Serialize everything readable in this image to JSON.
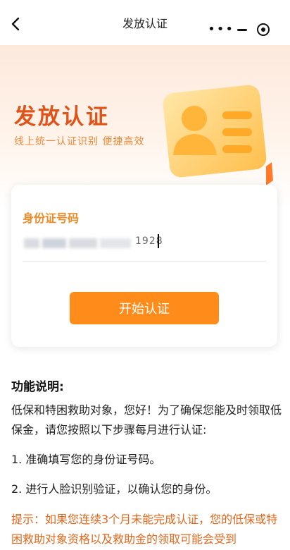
{
  "nav": {
    "title": "发放认证",
    "back_icon": "chevron-left-icon",
    "menu_icon": "more-dots-icon",
    "minimize_icon": "minus-icon",
    "close_icon": "target-circle-icon"
  },
  "hero": {
    "title": "发放认证",
    "subtitle": "线上统一认证识别 便捷高效",
    "illustration": "id-card-icon",
    "accent_color": "#e0541a"
  },
  "form": {
    "id_label": "身份证号码",
    "id_value_visible": "1928",
    "start_button": "开始认证",
    "button_color": "#ff8c1a"
  },
  "info": {
    "heading": "功能说明:",
    "intro": "低保和特困救助对象，您好！为了确保您能及时领取低保金，请您按照以下步骤每月进行认证:",
    "step1": "1. 准确填写您的身份证号码。",
    "step2": "2. 进行人脸识别验证，以确认您的身份。",
    "tip": "提示：如果您连续3个月未能完成认证，您的低保或特困救助对象资格以及救助金的领取可能会受到"
  }
}
